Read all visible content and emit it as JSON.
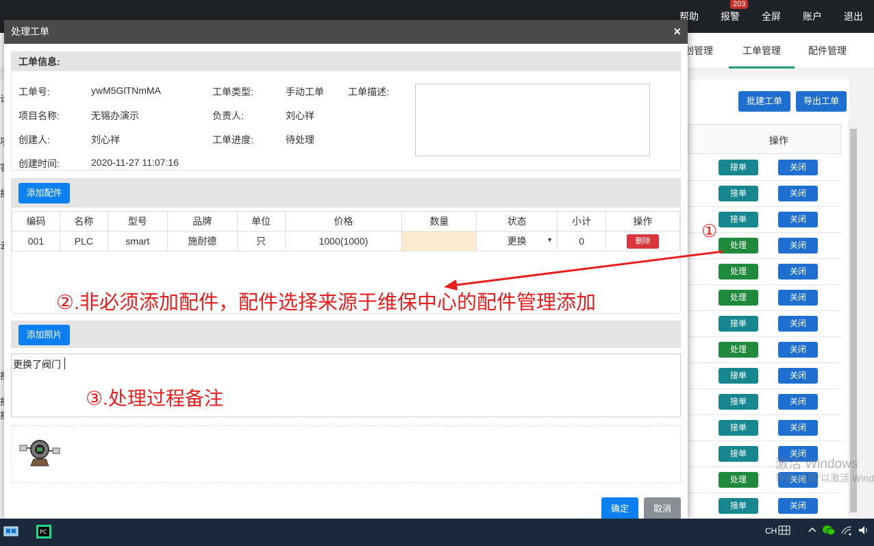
{
  "topnav": {
    "items": [
      "帮助",
      "报警",
      "全屏",
      "账户",
      "退出"
    ],
    "alarm_badge": "203"
  },
  "subnav": {
    "tabs": [
      "划管理",
      "工单管理",
      "配件管理"
    ]
  },
  "background": {
    "batch_button": "批建工单",
    "export_button": "导出工单",
    "table_header": "操作",
    "rows": [
      {
        "first": "接单",
        "second": "关闭"
      },
      {
        "first": "接单",
        "second": "关闭"
      },
      {
        "first": "接单",
        "second": "关闭"
      },
      {
        "first": "处理",
        "second": "关闭"
      },
      {
        "first": "处理",
        "second": "关闭"
      },
      {
        "first": "处理",
        "second": "关闭"
      },
      {
        "first": "接单",
        "second": "关闭"
      },
      {
        "first": "处理",
        "second": "关闭"
      },
      {
        "first": "接单",
        "second": "关闭"
      },
      {
        "first": "接单",
        "second": "关闭"
      },
      {
        "first": "接单",
        "second": "关闭"
      },
      {
        "first": "接单",
        "second": "关闭"
      },
      {
        "first": "处理",
        "second": "关闭"
      },
      {
        "first": "接单",
        "second": "关闭"
      }
    ],
    "left_glyphs": [
      "计",
      "项",
      "害",
      "报",
      "云",
      "报",
      "报",
      "报"
    ],
    "watermark_title": "激活 Windows",
    "watermark_sub": "转到\"设置\"以激活 Windows。"
  },
  "modal": {
    "title": "处理工单",
    "close": "×",
    "info": {
      "heading": "工单信息:",
      "order_no_label": "工单号:",
      "order_no": "ywM5GlTNmMA",
      "type_label": "工单类型:",
      "type": "手动工单",
      "desc_label": "工单描述:",
      "project_label": "项目名称:",
      "project": "无锡办演示",
      "owner_label": "负责人:",
      "owner": "刘心祥",
      "creator_label": "创建人:",
      "creator": "刘心祥",
      "progress_label": "工单进度:",
      "progress": "待处理",
      "created_label": "创建时间:",
      "created": "2020-11-27 11:07:16"
    },
    "parts": {
      "add_button": "添加配件",
      "headers": [
        "编码",
        "名称",
        "型号",
        "品牌",
        "单位",
        "价格",
        "数量",
        "状态",
        "小计",
        "操作"
      ],
      "row": {
        "code": "001",
        "name": "PLC",
        "model": "smart",
        "brand": "施耐德",
        "unit": "只",
        "price": "1000(1000)",
        "qty": "",
        "status": "更换",
        "subtotal": "0",
        "delete": "删除"
      }
    },
    "photo": {
      "add_button": "添加照片"
    },
    "remark": {
      "text": "更换了阀门"
    },
    "footer": {
      "confirm": "确定",
      "cancel": "取消"
    }
  },
  "annotations": {
    "marker1": "①",
    "note2": "②.非必须添加配件，配件选择来源于维保中心的配件管理添加",
    "note3": "③.处理过程备注"
  },
  "taskbar": {
    "lang": "CH"
  },
  "colors": {
    "primary": "#0c80f0",
    "annotation_red": "#e81e1e",
    "delete_red": "#d9363e",
    "header_gray": "#4a4a4a"
  }
}
